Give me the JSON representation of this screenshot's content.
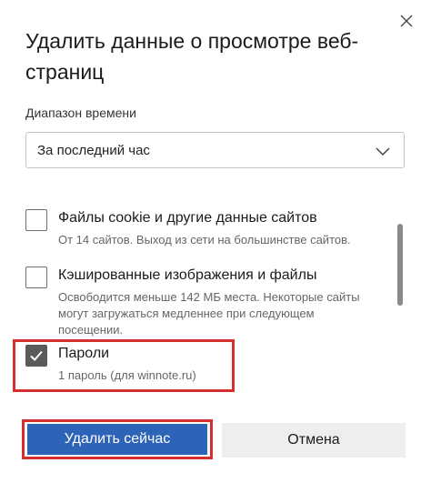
{
  "dialog": {
    "title": "Удалить данные о просмотре веб-страниц",
    "close_icon": "close-icon"
  },
  "time_range": {
    "label": "Диапазон времени",
    "selected": "За последний час",
    "icon": "chevron-down-icon"
  },
  "items": [
    {
      "title": "Файлы cookie и другие данные сайтов",
      "desc": "От 14 сайтов. Выход из сети на большинстве сайтов.",
      "checked": false
    },
    {
      "title": "Кэшированные изображения и файлы",
      "desc": "Освободится меньше 142 МБ места. Некоторые сайты могут загружаться медленнее при следующем посещении.",
      "checked": false
    },
    {
      "title": "Пароли",
      "desc": "1 пароль (для winnote.ru)",
      "checked": true
    }
  ],
  "buttons": {
    "delete_now": "Удалить сейчас",
    "cancel": "Отмена"
  },
  "colors": {
    "primary": "#2e64b8",
    "highlight": "#d32f2f",
    "checked": "#5a5a5a"
  }
}
